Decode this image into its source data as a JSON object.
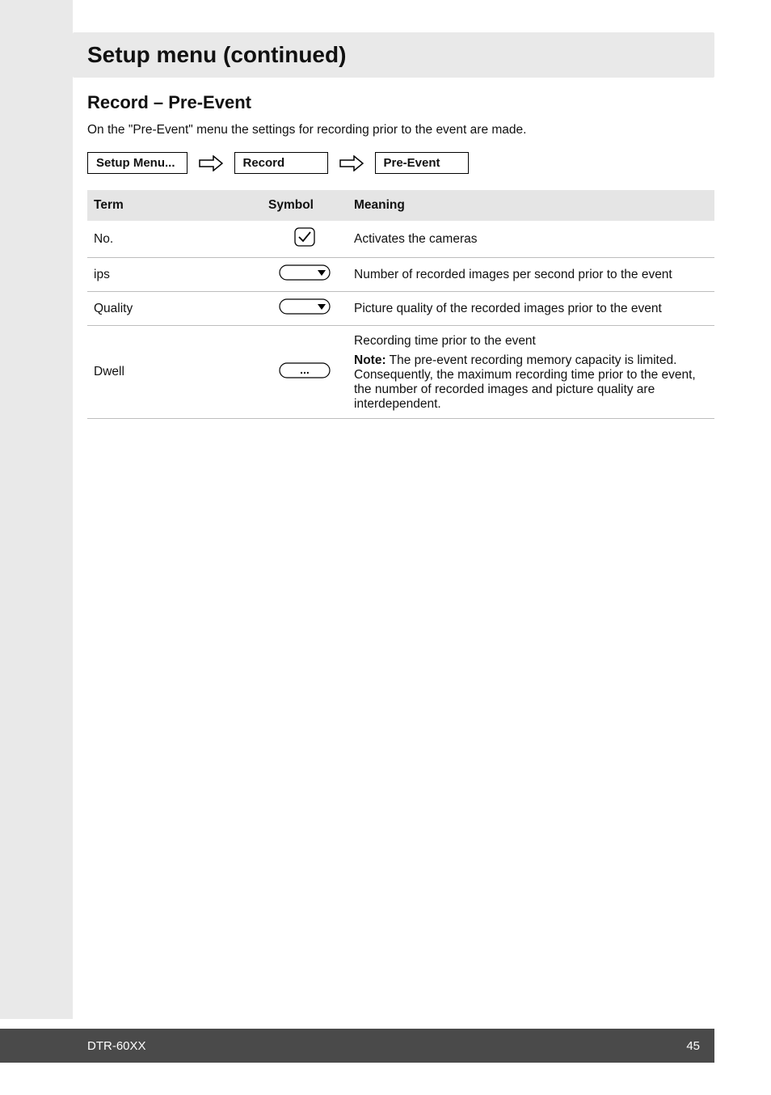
{
  "titleBar": {
    "text": "Setup menu (continued)"
  },
  "section": {
    "heading": "Record – Pre-Event",
    "intro": "On the \"Pre-Event\" menu the settings for recording prior to the event are made."
  },
  "breadcrumb": {
    "items": [
      "Setup Menu...",
      "Record",
      "Pre-Event"
    ]
  },
  "table": {
    "headers": {
      "term": "Term",
      "symbol": "Symbol",
      "meaning": "Meaning"
    },
    "rows": [
      {
        "term": "No.",
        "symbol": "check",
        "meaning": "Activates the cameras"
      },
      {
        "term": "ips",
        "symbol": "dropdown",
        "meaning": "Number of recorded images per second prior to the event"
      },
      {
        "term": "Quality",
        "symbol": "dropdown",
        "meaning": "Picture quality of the recorded images prior to the event"
      },
      {
        "term": "Dwell",
        "symbol": "ellipsis",
        "meaning": "Recording time prior to the event",
        "noteLabel": "Note:",
        "noteText": " The pre-event recording memory capacity is limited. Consequently, the maximum recording time prior to the event, the number of recorded images and picture quality are interdependent."
      }
    ]
  },
  "footer": {
    "model": "DTR-60XX",
    "page": "45"
  }
}
